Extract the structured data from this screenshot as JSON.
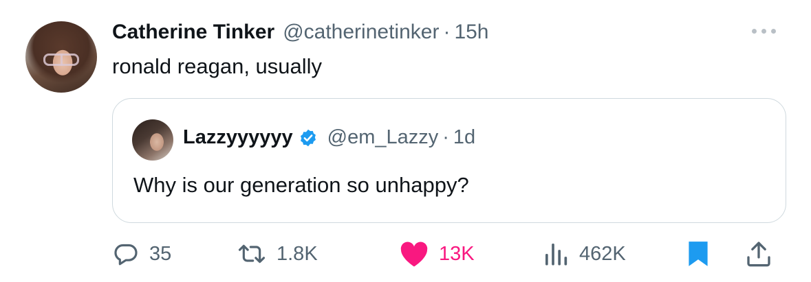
{
  "tweet": {
    "author_name": "Catherine Tinker",
    "author_handle": "@catherinetinker",
    "separator": "·",
    "time": "15h",
    "text": "ronald reagan, usually"
  },
  "quoted": {
    "author_name": "Lazzyyyyyy",
    "author_handle": "@em_Lazzy",
    "separator": "·",
    "time": "1d",
    "verified": true,
    "text": "Why is our generation so unhappy?"
  },
  "actions": {
    "replies": "35",
    "retweets": "1.8K",
    "likes": "13K",
    "views": "462K",
    "liked": true,
    "bookmarked": true
  },
  "icons": {
    "reply": "reply-icon",
    "retweet": "retweet-icon",
    "like": "heart-icon",
    "views": "views-icon",
    "bookmark": "bookmark-icon",
    "share": "share-icon",
    "more": "more-icon",
    "verified": "verified-badge-icon"
  },
  "colors": {
    "text": "#0f1419",
    "secondary": "#536471",
    "like": "#f91880",
    "bookmark": "#1d9bf0",
    "verified": "#1d9bf0",
    "border": "#cfd9de"
  }
}
